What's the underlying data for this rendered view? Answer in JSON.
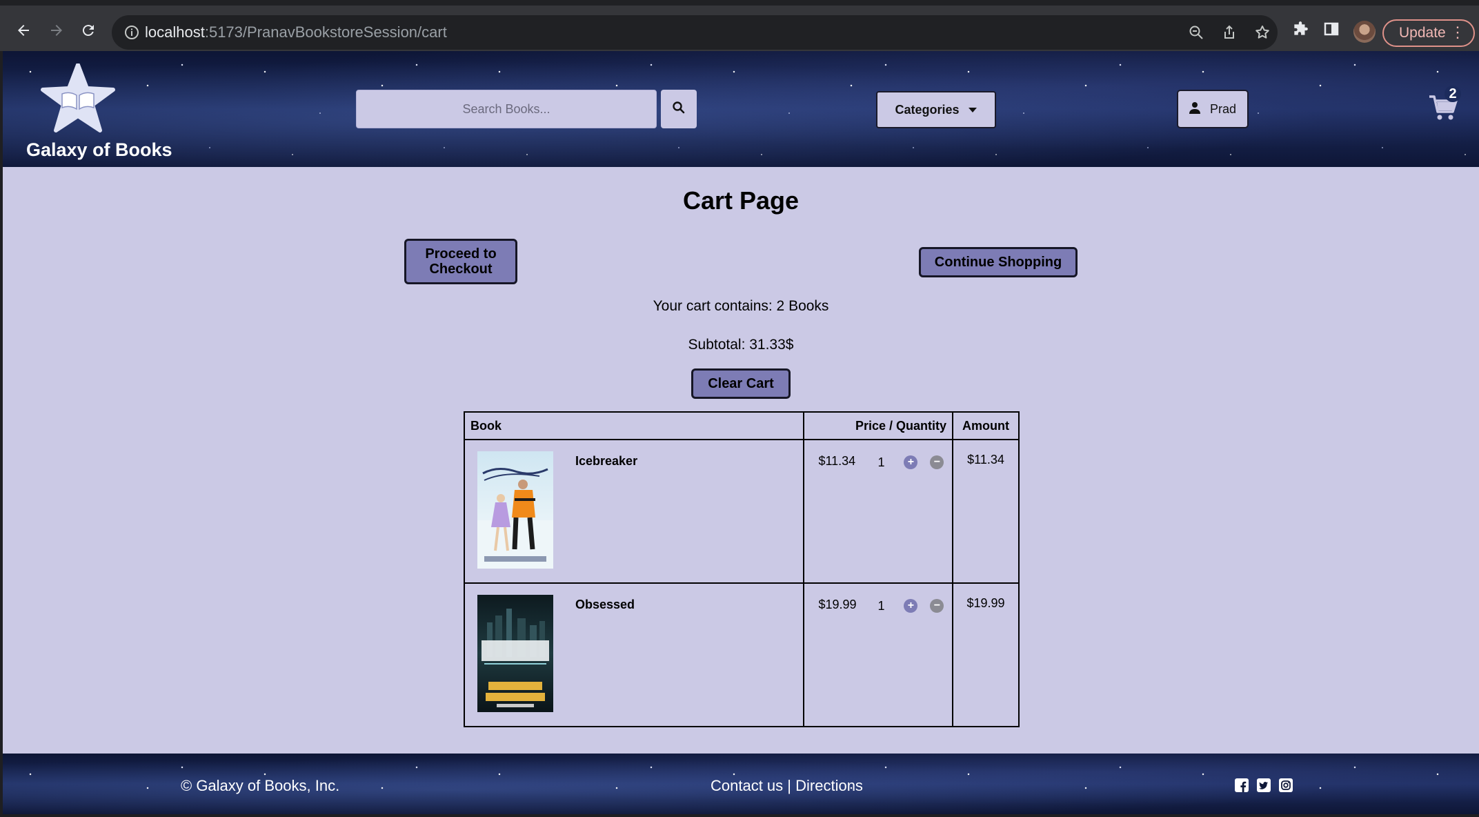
{
  "browser": {
    "url_host": "localhost",
    "url_path": ":5173/PranavBookstoreSession/cart",
    "update_label": "Update"
  },
  "header": {
    "brand": "Galaxy of Books",
    "search_placeholder": "Search Books...",
    "categories_label": "Categories",
    "user_label": "Prad",
    "cart_count": "2"
  },
  "cart": {
    "title": "Cart Page",
    "checkout_label": "Proceed to Checkout",
    "continue_label": "Continue Shopping",
    "count_text": "Your cart contains: 2 Books",
    "subtotal_text": "Subtotal: 31.33$",
    "clear_label": "Clear Cart",
    "columns": {
      "book": "Book",
      "price_qty": "Price / Quantity",
      "amount": "Amount"
    },
    "items": [
      {
        "title": "Icebreaker",
        "price": "$11.34",
        "quantity": "1",
        "amount": "$11.34"
      },
      {
        "title": "Obsessed",
        "price": "$19.99",
        "quantity": "1",
        "amount": "$19.99"
      }
    ]
  },
  "footer": {
    "copyright": "© Galaxy of Books, Inc.",
    "contact": "Contact us",
    "separator": " | ",
    "directions": "Directions"
  },
  "icons": [
    "back-icon",
    "forward-icon",
    "reload-icon",
    "info-icon",
    "zoom-icon",
    "share-icon",
    "star-bookmark-icon",
    "extensions-icon",
    "sidebar-icon",
    "search-icon",
    "caret-down-icon",
    "user-icon",
    "cart-icon",
    "facebook-icon",
    "twitter-icon",
    "instagram-icon"
  ],
  "colors": {
    "page_bg": "#cbc9e5",
    "button_accent": "#7d7cb5",
    "header_bg": "#0f1838"
  }
}
